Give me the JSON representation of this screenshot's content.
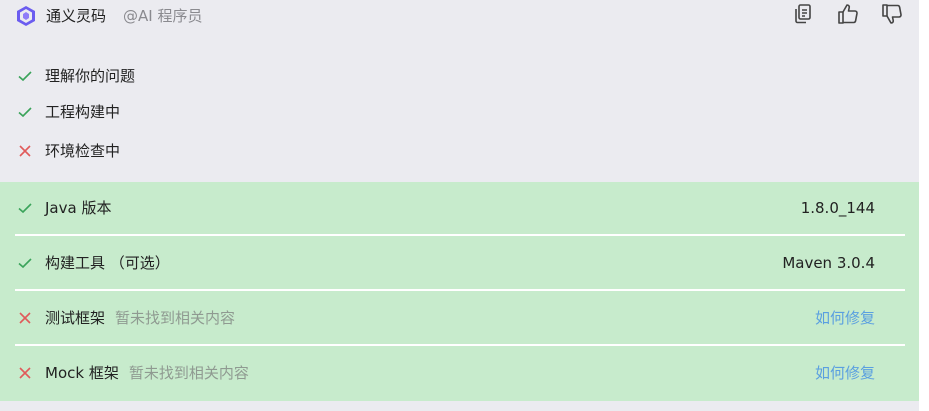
{
  "header": {
    "app_name": "通义灵码",
    "role": "@AI 程序员",
    "actions": {
      "copy_icon": "copy-icon",
      "like_icon": "thumbs-up-icon",
      "dislike_icon": "thumbs-down-icon"
    }
  },
  "steps": [
    {
      "label": "理解你的问题",
      "status": "success"
    },
    {
      "label": "工程构建中",
      "status": "success"
    },
    {
      "label": "环境检查中",
      "status": "failed"
    }
  ],
  "checks": [
    {
      "name": "Java 版本",
      "note": "",
      "value": "1.8.0_144",
      "status": "success"
    },
    {
      "name": "构建工具 （可选）",
      "note": "",
      "value": "Maven 3.0.4",
      "status": "success"
    },
    {
      "name": "测试框架",
      "note": "暂未找到相关内容",
      "link": "如何修复",
      "status": "failed"
    },
    {
      "name": "Mock 框架",
      "note": "暂未找到相关内容",
      "link": "如何修复",
      "status": "failed"
    }
  ],
  "colors": {
    "success": "#3aa35a",
    "failed": "#e05a5a",
    "panel_bg": "#ebebf0",
    "result_bg": "#c7ebcc",
    "link": "#5a9fe0"
  }
}
